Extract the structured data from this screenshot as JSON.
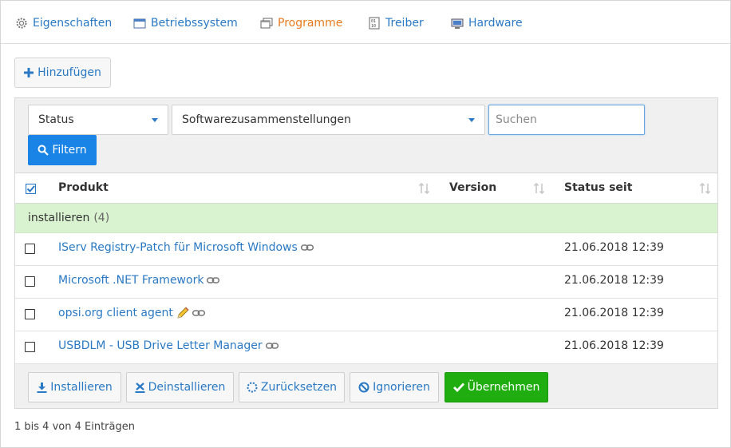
{
  "tabs": [
    {
      "label": "Eigenschaften",
      "icon": "gear-icon"
    },
    {
      "label": "Betriebssystem",
      "icon": "window-icon"
    },
    {
      "label": "Programme",
      "icon": "stacked-windows-icon",
      "active": true
    },
    {
      "label": "Treiber",
      "icon": "binary-file-icon"
    },
    {
      "label": "Hardware",
      "icon": "computer-icon"
    }
  ],
  "toolbar": {
    "add_label": "Hinzufügen"
  },
  "filters": {
    "status_select": "Status",
    "collection_select": "Softwarezusammenstellungen",
    "search_placeholder": "Suchen",
    "filter_label": "Filtern"
  },
  "table": {
    "headers": {
      "product": "Produkt",
      "version": "Version",
      "status_since": "Status seit"
    },
    "group": {
      "label": "installieren",
      "count": "(4)"
    },
    "rows": [
      {
        "product": "IServ Registry-Patch für Microsoft Windows",
        "version": "",
        "status_since": "21.06.2018 12:39",
        "edit": false
      },
      {
        "product": "Microsoft .NET Framework",
        "version": "",
        "status_since": "21.06.2018 12:39",
        "edit": false
      },
      {
        "product": "opsi.org client agent",
        "version": "",
        "status_since": "21.06.2018 12:39",
        "edit": true
      },
      {
        "product": "USBDLM - USB Drive Letter Manager",
        "version": "",
        "status_since": "21.06.2018 12:39",
        "edit": false
      }
    ]
  },
  "actions": {
    "install": "Installieren",
    "uninstall": "Deinstallieren",
    "reset": "Zurücksetzen",
    "ignore": "Ignorieren",
    "apply": "Übernehmen"
  },
  "footer": {
    "info": "1 bis 4 von 4 Einträgen"
  },
  "colors": {
    "link": "#2a79c4",
    "active_tab": "#e87a1d",
    "primary": "#1a84e6",
    "success": "#1fad0f",
    "group_bg": "#d9f2d0"
  }
}
